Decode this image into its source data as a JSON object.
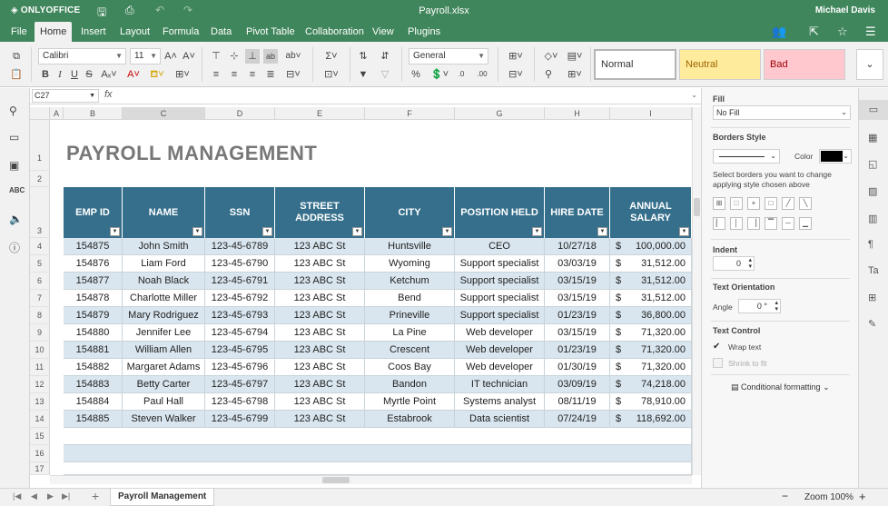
{
  "app": {
    "logo": "ONLYOFFICE",
    "file_title": "Payroll.xlsx",
    "user": "Michael Davis"
  },
  "menu": [
    "File",
    "Home",
    "Insert",
    "Layout",
    "Formula",
    "Data",
    "Pivot Table",
    "Collaboration",
    "View",
    "Plugins"
  ],
  "toolbar": {
    "font_name": "Calibri",
    "font_size": "11",
    "number_format": "General",
    "styles": [
      "Normal",
      "Neutral",
      "Bad"
    ]
  },
  "formula_bar": {
    "cell_ref": "C27",
    "fx": "fx"
  },
  "columns": [
    "A",
    "B",
    "C",
    "D",
    "E",
    "F",
    "G",
    "H",
    "I"
  ],
  "rows": [
    "1",
    "2",
    "3",
    "4",
    "5",
    "6",
    "7",
    "8",
    "9",
    "10",
    "11",
    "12",
    "13",
    "14",
    "15",
    "16",
    "17"
  ],
  "sheet": {
    "title": "PAYROLL MANAGEMENT",
    "headers": [
      "EMP ID",
      "NAME",
      "SSN",
      "STREET ADDRESS",
      "CITY",
      "POSITION HELD",
      "HIRE DATE",
      "ANNUAL SALARY"
    ],
    "rows": [
      [
        "154875",
        "John Smith",
        "123-45-6789",
        "123 ABC St",
        "Huntsville",
        "CEO",
        "10/27/18",
        "$",
        "100,000.00"
      ],
      [
        "154876",
        "Liam Ford",
        "123-45-6790",
        "123 ABC St",
        "Wyoming",
        "Support specialist",
        "03/03/19",
        "$",
        "31,512.00"
      ],
      [
        "154877",
        "Noah Black",
        "123-45-6791",
        "123 ABC St",
        "Ketchum",
        "Support specialist",
        "03/15/19",
        "$",
        "31,512.00"
      ],
      [
        "154878",
        "Charlotte Miller",
        "123-45-6792",
        "123 ABC St",
        "Bend",
        "Support specialist",
        "03/15/19",
        "$",
        "31,512.00"
      ],
      [
        "154879",
        "Mary Rodriguez",
        "123-45-6793",
        "123 ABC St",
        "Prineville",
        "Support specialist",
        "01/23/19",
        "$",
        "36,800.00"
      ],
      [
        "154880",
        "Jennifer Lee",
        "123-45-6794",
        "123 ABC St",
        "La Pine",
        "Web developer",
        "03/15/19",
        "$",
        "71,320.00"
      ],
      [
        "154881",
        "William Allen",
        "123-45-6795",
        "123 ABC St",
        "Crescent",
        "Web developer",
        "01/23/19",
        "$",
        "71,320.00"
      ],
      [
        "154882",
        "Margaret Adams",
        "123-45-6796",
        "123 ABC St",
        "Coos Bay",
        "Web developer",
        "01/30/19",
        "$",
        "71,320.00"
      ],
      [
        "154883",
        "Betty Carter",
        "123-45-6797",
        "123 ABC St",
        "Bandon",
        "IT technician",
        "03/09/19",
        "$",
        "74,218.00"
      ],
      [
        "154884",
        "Paul Hall",
        "123-45-6798",
        "123 ABC St",
        "Myrtle Point",
        "Systems analyst",
        "08/11/19",
        "$",
        "78,910.00"
      ],
      [
        "154885",
        "Steven Walker",
        "123-45-6799",
        "123 ABC St",
        "Estabrook",
        "Data scientist",
        "07/24/19",
        "$",
        "118,692.00"
      ]
    ]
  },
  "right_panel": {
    "fill_label": "Fill",
    "fill_value": "No Fill",
    "borders_label": "Borders Style",
    "color_label": "Color",
    "borders_hint": "Select borders you want to change applying style chosen above",
    "indent_label": "Indent",
    "indent_value": "0",
    "orientation_label": "Text Orientation",
    "angle_label": "Angle",
    "angle_value": "0 °",
    "text_control_label": "Text Control",
    "wrap_text": "Wrap text",
    "shrink_to_fit": "Shrink to fit",
    "cond_formatting": "Conditional formatting"
  },
  "status": {
    "sheet_tab": "Payroll Management",
    "zoom": "Zoom 100%"
  },
  "colors": {
    "brand": "#40865c",
    "header": "#356f8c",
    "band": "#d9e6ef",
    "neutral": "#ffeb9c",
    "bad": "#ffc7ce"
  }
}
